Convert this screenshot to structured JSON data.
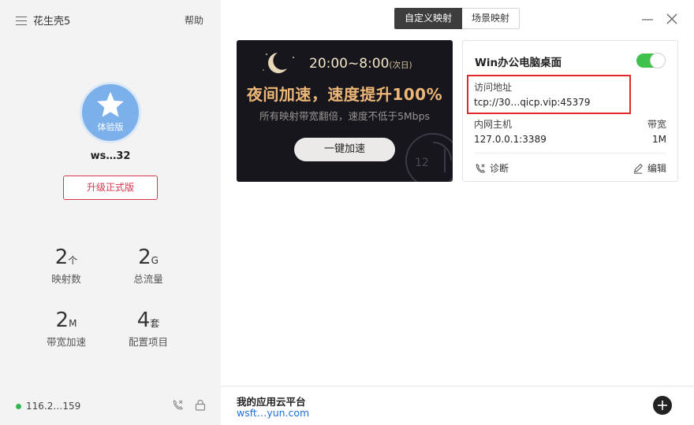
{
  "app": {
    "name": "花生壳5",
    "help": "帮助"
  },
  "user": {
    "avatar_label": "体验版",
    "username": "ws…32",
    "upgrade_label": "升级正式版"
  },
  "stats": [
    {
      "value": "2",
      "unit": "个",
      "label": "映射数"
    },
    {
      "value": "2",
      "unit": "G",
      "label": "总流量"
    },
    {
      "value": "2",
      "unit": "M",
      "label": "带宽加速"
    },
    {
      "value": "4",
      "unit": "套",
      "label": "配置项目"
    }
  ],
  "status": {
    "ip": "116.2…159",
    "online_color": "#32b84f"
  },
  "tabs": [
    {
      "label": "自定义映射",
      "active": true
    },
    {
      "label": "场景映射",
      "active": false
    }
  ],
  "banner": {
    "time": "20:00~8:00",
    "time_note": "(次日)",
    "title": "夜间加速，速度提升100%",
    "subtitle": "所有映射带宽翻倍，速度不低于5Mbps",
    "button": "一键加速",
    "clock_number": "12"
  },
  "mapping_card": {
    "title": "Win办公电脑桌面",
    "enabled": true,
    "address_label": "访问地址",
    "address": "tcp://30…qicp.vip:45379",
    "host_label": "内网主机",
    "host": "127.0.0.1:3389",
    "bandwidth_label": "带宽",
    "bandwidth": "1M",
    "diagnose_label": "诊断",
    "edit_label": "编辑",
    "highlight_color": "#e02a2a"
  },
  "footer": {
    "title": "我的应用云平台",
    "link": "wsft…yun.com"
  },
  "colors": {
    "accent_red": "#d8344d",
    "link_blue": "#1e6fd9",
    "toggle_green": "#3ec24a",
    "banner_gold": "#ecb777"
  }
}
